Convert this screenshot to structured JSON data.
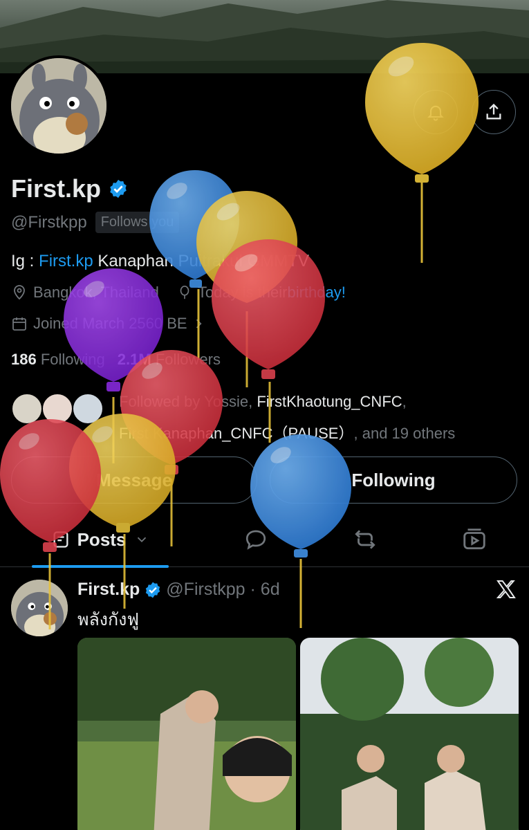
{
  "profile": {
    "display_name": "First.kp",
    "handle": "@Firstkpp",
    "follows_you": "Follows you",
    "bio_prefix": "Ig : ",
    "bio_link": "First.kp",
    "bio_rest": " Kanaphan Puitrakul GMMTV",
    "location": "Bangkok, Thailand",
    "birthday_prefix": "Today is their ",
    "birthday_link": "birthday!",
    "joined": "Joined March 2560 BE",
    "following_count": "186",
    "following_label": "Following",
    "followers_count": "2.1M",
    "followers_label": "Followers",
    "followed_by_prefix": "Followed by Yossie, ",
    "followed_by_user1": "FirstKhaotung_CNFC",
    "followed_by_sep": ",",
    "followed_by_user2": "First Kanaphan_CNFC（PAUSE）",
    "followed_by_suffix": ", and 19 others"
  },
  "actions": {
    "message_label": "Message",
    "following_label": "Following"
  },
  "tabs": {
    "posts_label": "Posts"
  },
  "post": {
    "name": "First.kp",
    "handle_time": "@Firstkpp · 6d",
    "text": "พลังกังฟู"
  },
  "colors": {
    "accent": "#1d9bf0",
    "muted": "#71767b",
    "text": "#e7e9ea",
    "balloon_yellow": "#e6c23a",
    "balloon_blue": "#3f8ee0",
    "balloon_red": "#e0424f",
    "balloon_purple": "#8a2be2"
  },
  "icons": [
    "bell-icon",
    "share-icon",
    "verified-badge-icon",
    "location-icon",
    "balloon-icon",
    "calendar-icon",
    "chevron-right-icon",
    "chevron-down-icon",
    "reply-icon",
    "repost-icon",
    "video-icon",
    "x-logo-icon"
  ]
}
